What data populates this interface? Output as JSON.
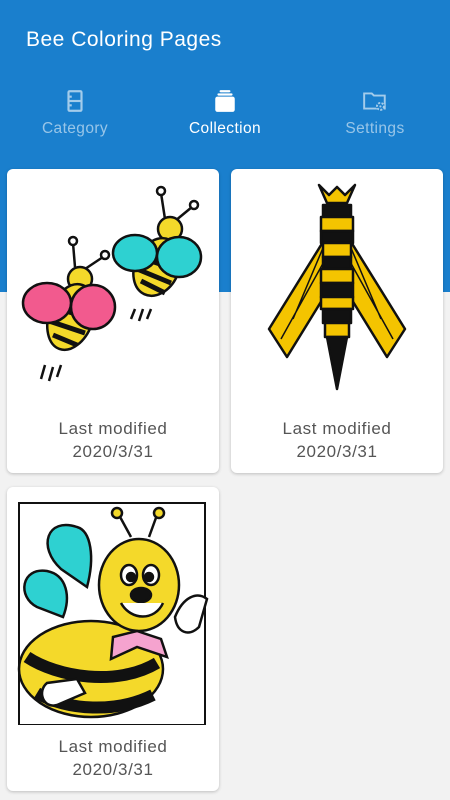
{
  "app": {
    "title": "Bee Coloring Pages"
  },
  "tabs": [
    {
      "label": "Category",
      "icon": "cabinet-icon",
      "active": false
    },
    {
      "label": "Collection",
      "icon": "layers-icon",
      "active": true
    },
    {
      "label": "Settings",
      "icon": "folder-gear-icon",
      "active": false
    }
  ],
  "cards": [
    {
      "modified_label": "Last modified",
      "date": "2020/3/31",
      "subject": "two-flying-bees"
    },
    {
      "modified_label": "Last modified",
      "date": "2020/3/31",
      "subject": "geometric-bee"
    },
    {
      "modified_label": "Last modified",
      "date": "2020/3/31",
      "subject": "waving-cartoon-bee"
    }
  ],
  "colors": {
    "header": "#1a7fcd",
    "background": "#f2f2f2"
  }
}
